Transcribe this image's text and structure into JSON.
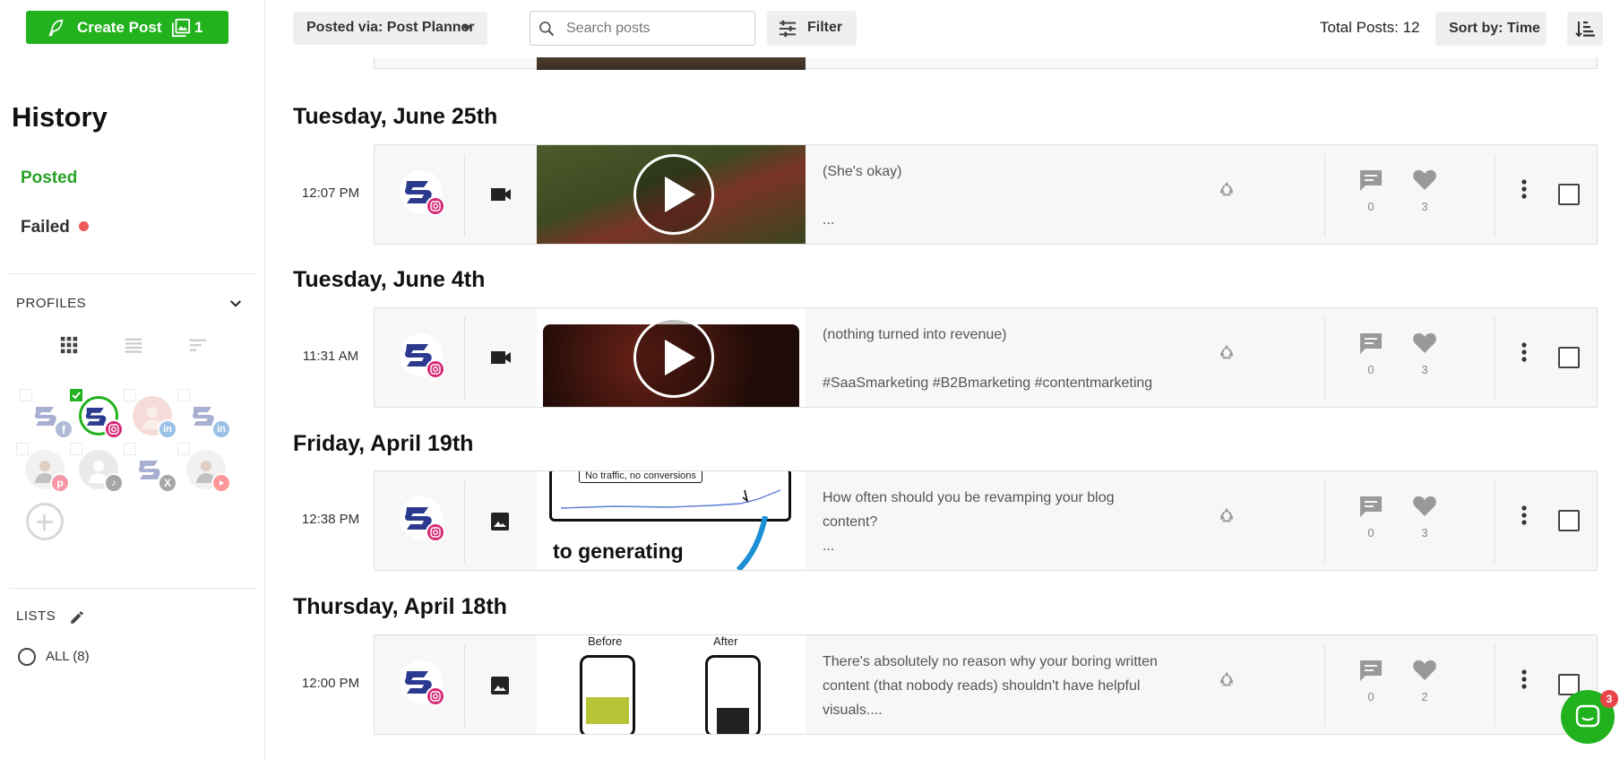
{
  "create_post": {
    "label": "Create Post",
    "count": "1"
  },
  "sidebar": {
    "title": "History",
    "nav": {
      "posted": "Posted",
      "failed": "Failed"
    },
    "profiles_label": "PROFILES",
    "lists_label": "LISTS",
    "list_all": "ALL (8)",
    "profiles": [
      {
        "network": "facebook",
        "color": "#3b5998",
        "selected": false
      },
      {
        "network": "instagram",
        "color": "#d62976",
        "selected": true
      },
      {
        "network": "linkedin",
        "color": "#0a66c2",
        "selected": false
      },
      {
        "network": "linkedin",
        "color": "#0a66c2",
        "selected": false
      },
      {
        "network": "pinterest",
        "color": "#e60023",
        "selected": false
      },
      {
        "network": "tiktok",
        "color": "#222222",
        "selected": false
      },
      {
        "network": "x",
        "color": "#222222",
        "selected": false
      },
      {
        "network": "youtube",
        "color": "#ff0000",
        "selected": false
      }
    ]
  },
  "topbar": {
    "posted_via": "Posted via: Post Planner",
    "search_placeholder": "Search posts",
    "filter_label": "Filter",
    "total_posts": "Total Posts: 12",
    "sort_label": "Sort by: Time"
  },
  "days": [
    {
      "label": "Tuesday, June 25th"
    },
    {
      "label": "Tuesday, June 4th"
    },
    {
      "label": "Friday, April 19th"
    },
    {
      "label": "Thursday, April 18th"
    }
  ],
  "posts": [
    {
      "time": "12:07 PM",
      "type": "video",
      "line1": "(She's okay)",
      "line2": "",
      "line3": "...",
      "comments": "0",
      "likes": "3"
    },
    {
      "time": "11:31 AM",
      "type": "video",
      "line1": "(nothing turned into revenue)",
      "line2": "",
      "line3": "#SaaSmarketing #B2Bmarketing #contentmarketing",
      "comments": "0",
      "likes": "3"
    },
    {
      "time": "12:38 PM",
      "type": "image",
      "line1": "How often should you be revamping your blog",
      "line2": "content?",
      "line3": "...",
      "comments": "0",
      "likes": "3",
      "media_text_1": "No traffic, no conversions",
      "media_text_2": "to generating"
    },
    {
      "time": "12:00 PM",
      "type": "image",
      "line1": "There's absolutely no reason why your boring written",
      "line2": "content (that nobody reads) shouldn't have helpful",
      "line3": "visuals....",
      "comments": "0",
      "likes": "2",
      "media_before": "Before",
      "media_after": "After"
    }
  ],
  "chat_badge": "3",
  "colors": {
    "brand_green": "#22b21e",
    "posted_green": "#25a325",
    "failed_dot": "#ee5a5a"
  }
}
